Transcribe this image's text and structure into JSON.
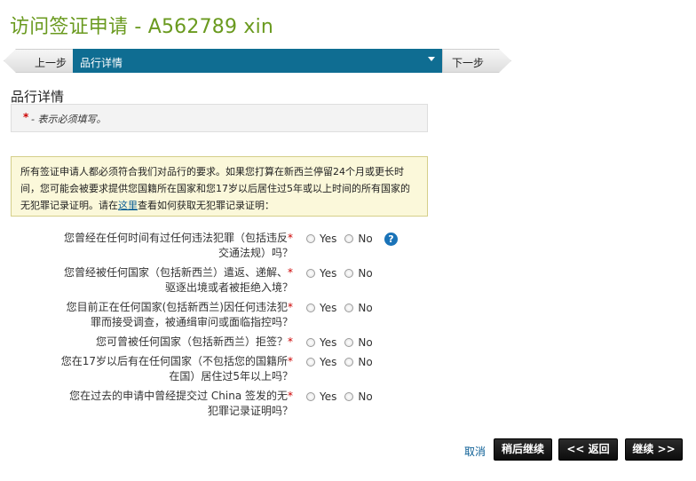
{
  "page": {
    "title": "访问签证申请 - A562789 xin"
  },
  "stepnav": {
    "prev_label": "上一步",
    "current_label": "品行详情",
    "next_label": "下一步"
  },
  "section": {
    "title": "品行详情",
    "required_star": "*",
    "required_note": "- 表示必须填写。"
  },
  "notice": {
    "text_before": "所有签证申请人都必须符合我们对品行的要求。如果您打算在新西兰停留24个月或更长时间，您可能会被要求提供您国籍所在国家和您17岁以后居住过5年或以上时间的所有国家的无犯罪记录证明。请在",
    "link": "这里",
    "text_after": "查看如何获取无犯罪记录证明："
  },
  "options": {
    "yes": "Yes",
    "no": "No"
  },
  "questions": [
    {
      "line1": "您曾经在任何时间有过任何违法犯罪（包括违反",
      "line2": "交通法规）吗？"
    },
    {
      "line1": "您曾经被任何国家（包括新西兰）遣返、递解、",
      "line2": "驱逐出境或者被拒绝入境？"
    },
    {
      "line1": "您目前正在任何国家(包括新西兰)因任何违法犯",
      "line2": "罪而接受调查，被通缉审问或面临指控吗？"
    },
    {
      "line1": "您可曾被任何国家（包括新西兰）拒签？",
      "line2": ""
    },
    {
      "line1": "您在17岁以后有在任何国家（不包括您的国籍所",
      "line2": "在国）居住过5年以上吗？"
    },
    {
      "line1": "您在过去的申请中曾经提交过 China 签发的无",
      "line2": "犯罪记录证明吗？"
    }
  ],
  "req_mark": "*",
  "help_glyph": "?",
  "footer": {
    "cancel": "取消",
    "save_later": "稍后继续",
    "back": "<< 返回",
    "continue": "继续 >>"
  },
  "colors": {
    "title_green": "#6a9a1f",
    "step_blue": "#0f6d92",
    "notice_bg": "#fbf8da",
    "required_red": "#cc0000"
  }
}
